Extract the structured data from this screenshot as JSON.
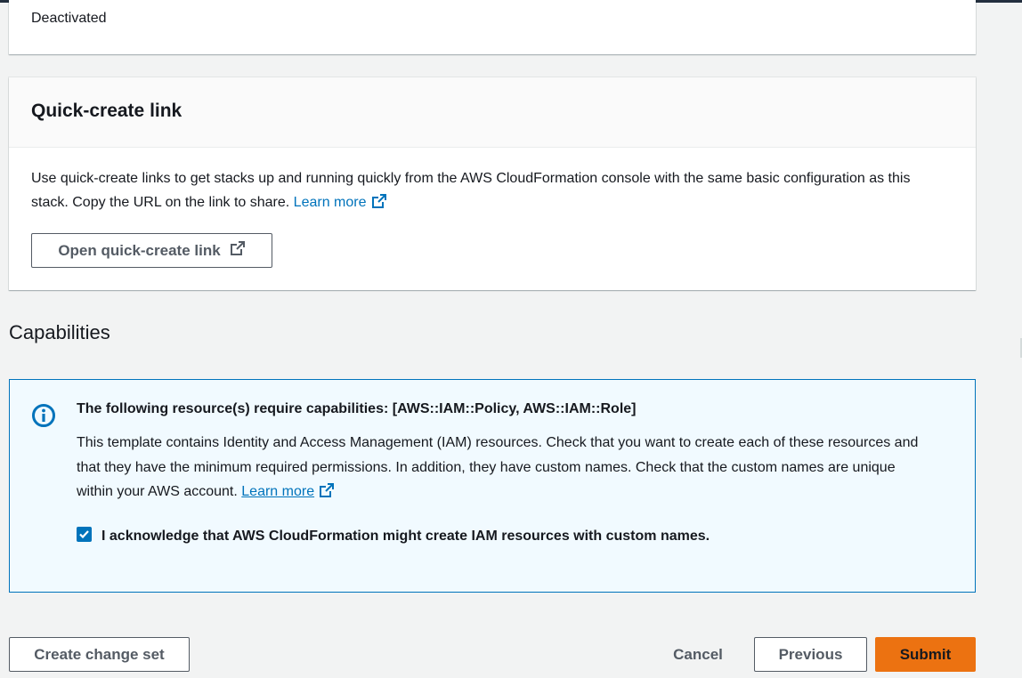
{
  "status_card": {
    "status_text": "Deactivated"
  },
  "quick_create": {
    "title": "Quick-create link",
    "description": "Use quick-create links to get stacks up and running quickly from the AWS CloudFormation console with the same basic configuration as this stack. Copy the URL on the link to share.",
    "learn_more": "Learn more",
    "open_button_label": "Open quick-create link"
  },
  "capabilities": {
    "section_title": "Capabilities",
    "alert_title": "The following resource(s) require capabilities: [AWS::IAM::Policy, AWS::IAM::Role]",
    "alert_body": "This template contains Identity and Access Management (IAM) resources. Check that you want to create each of these resources and that they have the minimum required permissions. In addition, they have custom names. Check that the custom names are unique within your AWS account.",
    "learn_more": "Learn more",
    "acknowledge_label": "I acknowledge that AWS CloudFormation might create IAM resources with custom names.",
    "acknowledge_checked": true
  },
  "footer": {
    "create_change_set_label": "Create change set",
    "cancel_label": "Cancel",
    "previous_label": "Previous",
    "submit_label": "Submit"
  },
  "colors": {
    "link": "#0073bb",
    "primary_button": "#ec7211",
    "alert_bg": "#f1faff",
    "alert_border": "#0073bb"
  },
  "icons": {
    "external_link": "external-link-icon",
    "info": "info-icon",
    "checkmark": "checkmark-icon"
  }
}
